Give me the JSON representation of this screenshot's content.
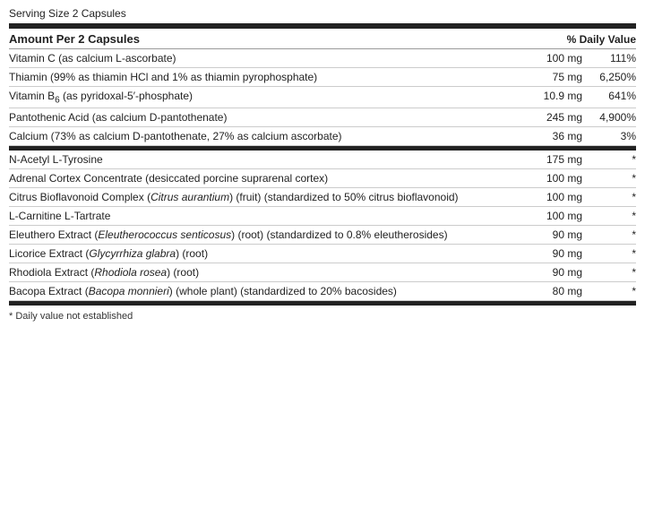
{
  "panel": {
    "serving_size_label": "Serving Size 2 Capsules",
    "header": {
      "left": "Amount Per 2 Capsules",
      "right": "% Daily Value"
    },
    "nutrients_section1": [
      {
        "name": "Vitamin C (as calcium L-ascorbate)",
        "amount": "100 mg",
        "dv": "111%"
      },
      {
        "name": "Thiamin (99% as thiamin HCl and 1% as thiamin pyrophosphate)",
        "amount": "75 mg",
        "dv": "6,250%"
      },
      {
        "name": "Vitamin B₆ (as pyridoxal-5'-phosphate)",
        "amount": "10.9 mg",
        "dv": "641%",
        "has_subscript": true,
        "subscript_char": "6",
        "name_prefix": "Vitamin B",
        "name_suffix": " (as pyridoxal-5’-phosphate)"
      },
      {
        "name": "Pantothenic Acid (as calcium D-pantothenate)",
        "amount": "245 mg",
        "dv": "4,900%"
      },
      {
        "name": "Calcium (73% as calcium D-pantothenate, 27% as calcium ascorbate)",
        "amount": "36 mg",
        "dv": "3%"
      }
    ],
    "nutrients_section2": [
      {
        "name": "N-Acetyl L-Tyrosine",
        "amount": "175 mg",
        "dv": "*"
      },
      {
        "name": "Adrenal Cortex Concentrate (desiccated porcine suprarenal cortex)",
        "amount": "100 mg",
        "dv": "*"
      },
      {
        "name_html": "Citrus Bioflavonoid Complex (<em>Citrus aurantium</em>) (fruit) (standardized to 50% citrus bioflavonoid)",
        "amount": "100 mg",
        "dv": "*"
      },
      {
        "name": "L-Carnitine L-Tartrate",
        "amount": "100 mg",
        "dv": "*"
      },
      {
        "name_html": "Eleuthero Extract (<em>Eleutherococcus senticosus</em>) (root) (standardized to 0.8% eleutherosides)",
        "amount": "90 mg",
        "dv": "*"
      },
      {
        "name_html": "Licorice Extract (<em>Glycyrrhiza glabra</em>) (root)",
        "amount": "90 mg",
        "dv": "*"
      },
      {
        "name_html": "Rhodiola Extract (<em>Rhodiola rosea</em>) (root)",
        "amount": "90 mg",
        "dv": "*"
      },
      {
        "name_html": "Bacopa Extract (<em>Bacopa monnieri</em>) (whole plant) (standardized to 20% bacosides)",
        "amount": "80 mg",
        "dv": "*"
      }
    ],
    "footnote": "* Daily value not established"
  }
}
